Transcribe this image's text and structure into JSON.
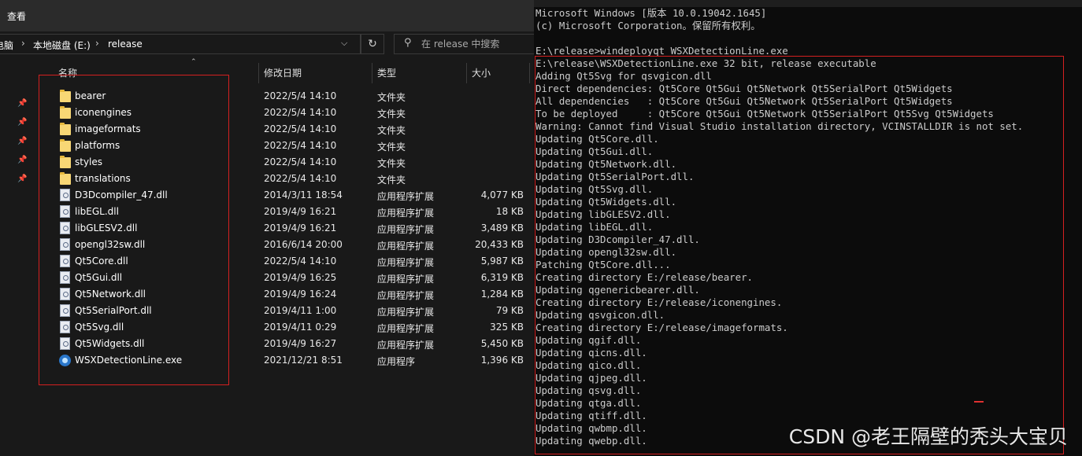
{
  "explorer": {
    "ribbon_tab": "查看",
    "breadcrumb": [
      "电脑",
      "本地磁盘 (E:)",
      "release"
    ],
    "search_placeholder": "在 release 中搜索",
    "columns": {
      "name": "名称",
      "date": "修改日期",
      "type": "类型",
      "size": "大小"
    },
    "files": [
      {
        "name": "bearer",
        "date": "2022/5/4 14:10",
        "type": "文件夹",
        "size": "",
        "icon": "folder-icon"
      },
      {
        "name": "iconengines",
        "date": "2022/5/4 14:10",
        "type": "文件夹",
        "size": "",
        "icon": "folder-icon"
      },
      {
        "name": "imageformats",
        "date": "2022/5/4 14:10",
        "type": "文件夹",
        "size": "",
        "icon": "folder-icon"
      },
      {
        "name": "platforms",
        "date": "2022/5/4 14:10",
        "type": "文件夹",
        "size": "",
        "icon": "folder-icon"
      },
      {
        "name": "styles",
        "date": "2022/5/4 14:10",
        "type": "文件夹",
        "size": "",
        "icon": "folder-icon"
      },
      {
        "name": "translations",
        "date": "2022/5/4 14:10",
        "type": "文件夹",
        "size": "",
        "icon": "folder-icon"
      },
      {
        "name": "D3Dcompiler_47.dll",
        "date": "2014/3/11 18:54",
        "type": "应用程序扩展",
        "size": "4,077 KB",
        "icon": "dll-icon"
      },
      {
        "name": "libEGL.dll",
        "date": "2019/4/9 16:21",
        "type": "应用程序扩展",
        "size": "18 KB",
        "icon": "dll-icon"
      },
      {
        "name": "libGLESV2.dll",
        "date": "2019/4/9 16:21",
        "type": "应用程序扩展",
        "size": "3,489 KB",
        "icon": "dll-icon"
      },
      {
        "name": "opengl32sw.dll",
        "date": "2016/6/14 20:00",
        "type": "应用程序扩展",
        "size": "20,433 KB",
        "icon": "dll-icon"
      },
      {
        "name": "Qt5Core.dll",
        "date": "2022/5/4 14:10",
        "type": "应用程序扩展",
        "size": "5,987 KB",
        "icon": "dll-icon"
      },
      {
        "name": "Qt5Gui.dll",
        "date": "2019/4/9 16:25",
        "type": "应用程序扩展",
        "size": "6,319 KB",
        "icon": "dll-icon"
      },
      {
        "name": "Qt5Network.dll",
        "date": "2019/4/9 16:24",
        "type": "应用程序扩展",
        "size": "1,284 KB",
        "icon": "dll-icon"
      },
      {
        "name": "Qt5SerialPort.dll",
        "date": "2019/4/11 1:00",
        "type": "应用程序扩展",
        "size": "79 KB",
        "icon": "dll-icon"
      },
      {
        "name": "Qt5Svg.dll",
        "date": "2019/4/11 0:29",
        "type": "应用程序扩展",
        "size": "325 KB",
        "icon": "dll-icon"
      },
      {
        "name": "Qt5Widgets.dll",
        "date": "2019/4/9 16:27",
        "type": "应用程序扩展",
        "size": "5,450 KB",
        "icon": "dll-icon"
      },
      {
        "name": "WSXDetectionLine.exe",
        "date": "2021/12/21 8:51",
        "type": "应用程序",
        "size": "1,396 KB",
        "icon": "exe-icon"
      }
    ]
  },
  "console": {
    "lines": [
      "Microsoft Windows [版本 10.0.19042.1645]",
      "(c) Microsoft Corporation。保留所有权利。",
      "",
      "E:\\release>windeployqt WSXDetectionLine.exe",
      "E:\\release\\WSXDetectionLine.exe 32 bit, release executable",
      "Adding Qt5Svg for qsvgicon.dll",
      "Direct dependencies: Qt5Core Qt5Gui Qt5Network Qt5SerialPort Qt5Widgets",
      "All dependencies   : Qt5Core Qt5Gui Qt5Network Qt5SerialPort Qt5Widgets",
      "To be deployed     : Qt5Core Qt5Gui Qt5Network Qt5SerialPort Qt5Svg Qt5Widgets",
      "Warning: Cannot find Visual Studio installation directory, VCINSTALLDIR is not set.",
      "Updating Qt5Core.dll.",
      "Updating Qt5Gui.dll.",
      "Updating Qt5Network.dll.",
      "Updating Qt5SerialPort.dll.",
      "Updating Qt5Svg.dll.",
      "Updating Qt5Widgets.dll.",
      "Updating libGLESV2.dll.",
      "Updating libEGL.dll.",
      "Updating D3Dcompiler_47.dll.",
      "Updating opengl32sw.dll.",
      "Patching Qt5Core.dll...",
      "Creating directory E:/release/bearer.",
      "Updating qgenericbearer.dll.",
      "Creating directory E:/release/iconengines.",
      "Updating qsvgicon.dll.",
      "Creating directory E:/release/imageformats.",
      "Updating qgif.dll.",
      "Updating qicns.dll.",
      "Updating qico.dll.",
      "Updating qjpeg.dll.",
      "Updating qsvg.dll.",
      "Updating qtga.dll.",
      "Updating qtiff.dll.",
      "Updating qwbmp.dll.",
      "Updating qwebp.dll."
    ]
  },
  "watermark": "CSDN @老王隔壁的秃头大宝贝",
  "colors": {
    "highlight_box": "#d42020",
    "folder": "#f8d775",
    "explorer_bg": "#191919",
    "console_bg": "#0c0c0c"
  }
}
